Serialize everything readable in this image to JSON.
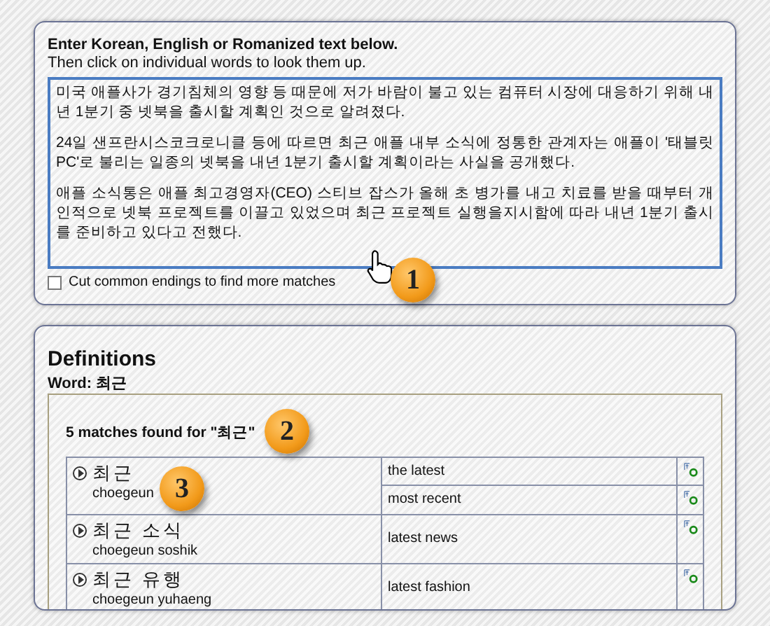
{
  "input_panel": {
    "heading": "Enter Korean, English or Romanized text below.",
    "subheading": "Then click on individual words to look them up.",
    "text_paragraphs": [
      "미국 애플사가 경기침체의 영향 등 때문에 저가 바람이 불고 있는 컴퓨터 시장에 대응하기 위해 내년 1분기 중 넷북을 출시할 계획인 것으로 알려졌다.",
      "24일 샌프란시스코크로니클 등에 따르면 최근 애플 내부 소식에 정통한 관계자는 애플이 '태블릿 PC'로 불리는 일종의 넷북을 내년 1분기 출시할 계획이라는 사실을 공개했다.",
      "애플 소식통은 애플 최고경영자(CEO) 스티브 잡스가 올해 초 병가를 내고 치료를 받을 때부터 개인적으로 넷북 프로젝트를 이끌고 있었으며 최근 프로젝트 실행을지시함에 따라 내년 1분기 출시를 준비하고 있다고 전했다."
    ],
    "option": {
      "label": "Cut common endings to find more matches",
      "checked": false
    },
    "callout": "1"
  },
  "definitions": {
    "title": "Definitions",
    "word_label": "Word: 최근",
    "matches": "5 matches found for \"최근\"",
    "callout_matches": "2",
    "callout_entry": "3",
    "entries": [
      {
        "hangul": "최근",
        "romanization": "choegeun",
        "meanings": [
          "the latest",
          "most recent"
        ]
      },
      {
        "hangul": "최근 소식",
        "romanization": "choegeun soshik",
        "meanings": [
          "latest news"
        ]
      },
      {
        "hangul": "최근 유행",
        "romanization": "choegeun yuhaeng",
        "meanings": [
          "latest fashion"
        ]
      }
    ]
  }
}
